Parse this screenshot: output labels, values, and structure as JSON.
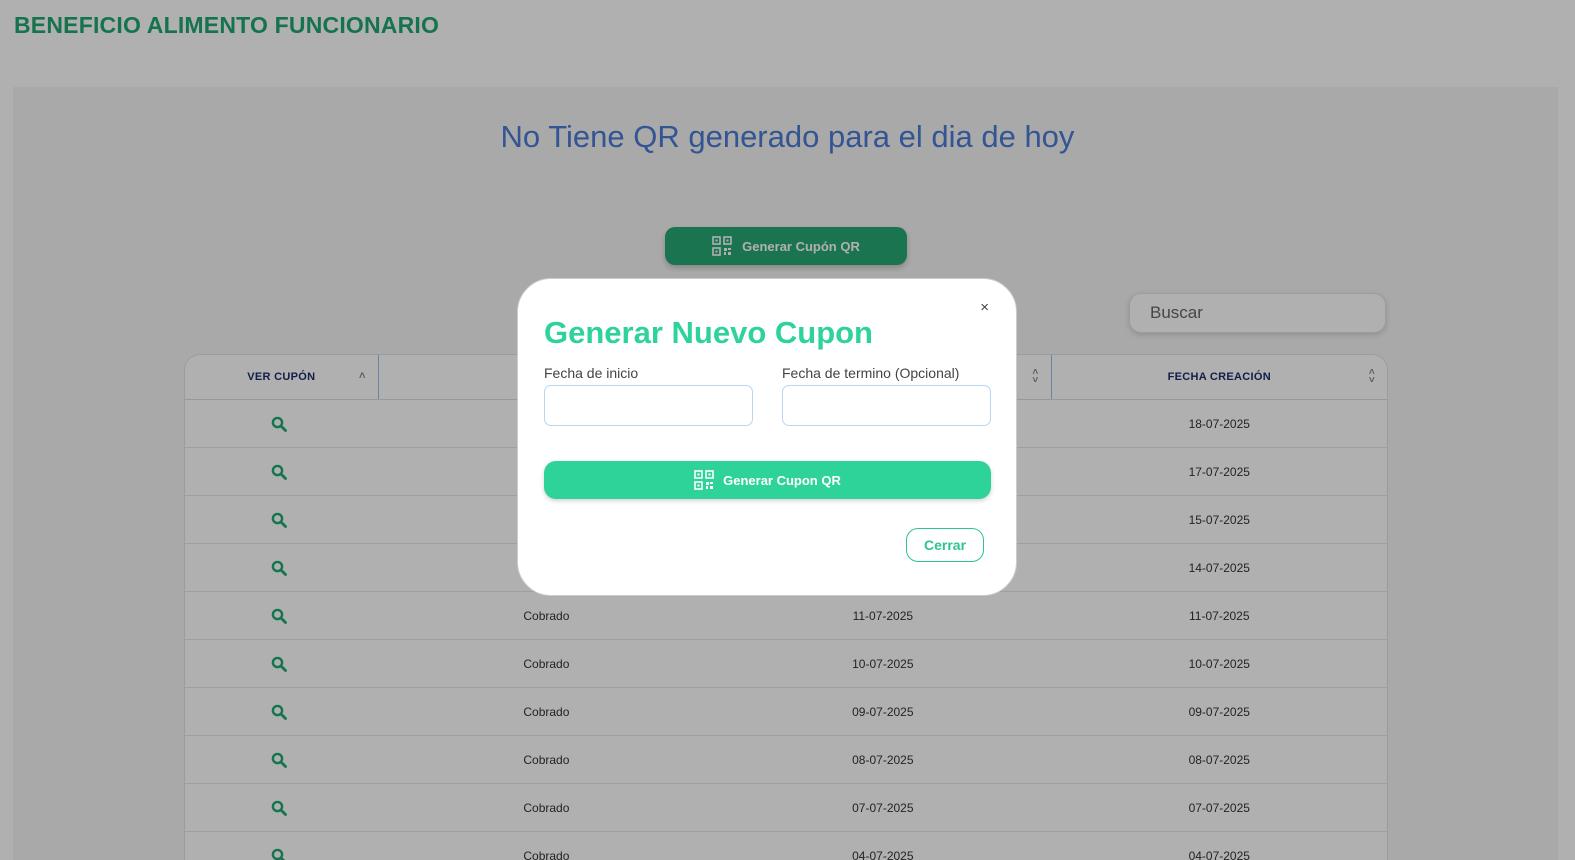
{
  "header": {
    "app_title": "BENEFICIO ALIMENTO FUNCIONARIO"
  },
  "main": {
    "headline": "No Tiene QR generado para el dia de hoy",
    "generate_button_label": "Generar Cupón QR",
    "search_placeholder": "Buscar"
  },
  "table": {
    "columns": [
      {
        "label": "VER CUPÓN",
        "sort": "asc"
      },
      {
        "label": "",
        "sort": "none"
      },
      {
        "label": "",
        "sort": "both"
      },
      {
        "label": "FECHA CREACIÓN",
        "sort": "both"
      }
    ],
    "rows": [
      {
        "estado": "",
        "fecha": "",
        "creacion": "18-07-2025"
      },
      {
        "estado": "",
        "fecha": "",
        "creacion": "17-07-2025"
      },
      {
        "estado": "",
        "fecha": "",
        "creacion": "15-07-2025"
      },
      {
        "estado": "",
        "fecha": "",
        "creacion": "14-07-2025"
      },
      {
        "estado": "Cobrado",
        "fecha": "11-07-2025",
        "creacion": "11-07-2025"
      },
      {
        "estado": "Cobrado",
        "fecha": "10-07-2025",
        "creacion": "10-07-2025"
      },
      {
        "estado": "Cobrado",
        "fecha": "09-07-2025",
        "creacion": "09-07-2025"
      },
      {
        "estado": "Cobrado",
        "fecha": "08-07-2025",
        "creacion": "08-07-2025"
      },
      {
        "estado": "Cobrado",
        "fecha": "07-07-2025",
        "creacion": "07-07-2025"
      },
      {
        "estado": "Cobrado",
        "fecha": "04-07-2025",
        "creacion": "04-07-2025"
      }
    ]
  },
  "modal": {
    "title": "Generar Nuevo Cupon",
    "close_symbol": "×",
    "start_label": "Fecha de inicio",
    "end_label": "Fecha de termino (Opcional)",
    "start_value": "",
    "end_value": "",
    "generate_label": "Generar Cupon QR",
    "close_label": "Cerrar"
  },
  "colors": {
    "brand_green": "#26a874",
    "modal_green": "#2ed39a",
    "headline_blue": "#4a7bd6"
  },
  "icons": {
    "row_action": "search-icon",
    "generate": "qr-code-icon"
  }
}
